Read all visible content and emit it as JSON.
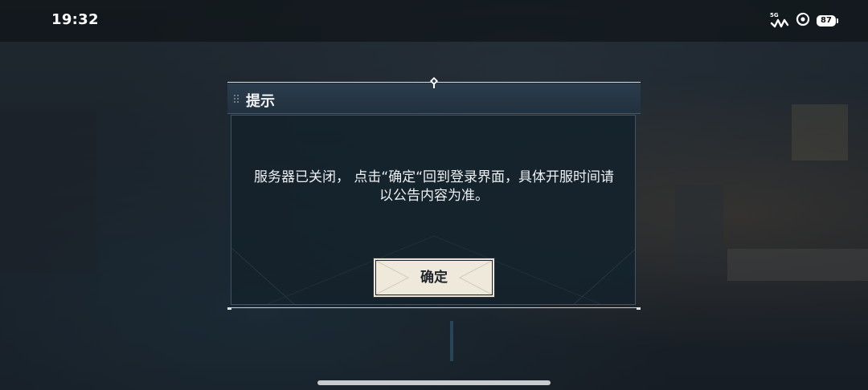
{
  "status_bar": {
    "time": "19:32",
    "network": "5G",
    "battery": "87"
  },
  "dialog": {
    "title": "提示",
    "message_line1": "服务器已关闭， 点击“确定“回到登录界面，具体开服时间请",
    "message_line2": "以公告内容为准。",
    "confirm_label": "确定"
  },
  "icons": {
    "status": [
      "signal-5g-icon",
      "hotspot-icon",
      "battery-icon"
    ],
    "dialog": [
      "drag-grip-icon",
      "top-ornament-icon"
    ]
  },
  "colors": {
    "dialog_header": "#2a3c4c",
    "dialog_body": "#14222c",
    "button_bg": "#efe9dc",
    "text_light": "#eef1f3"
  }
}
